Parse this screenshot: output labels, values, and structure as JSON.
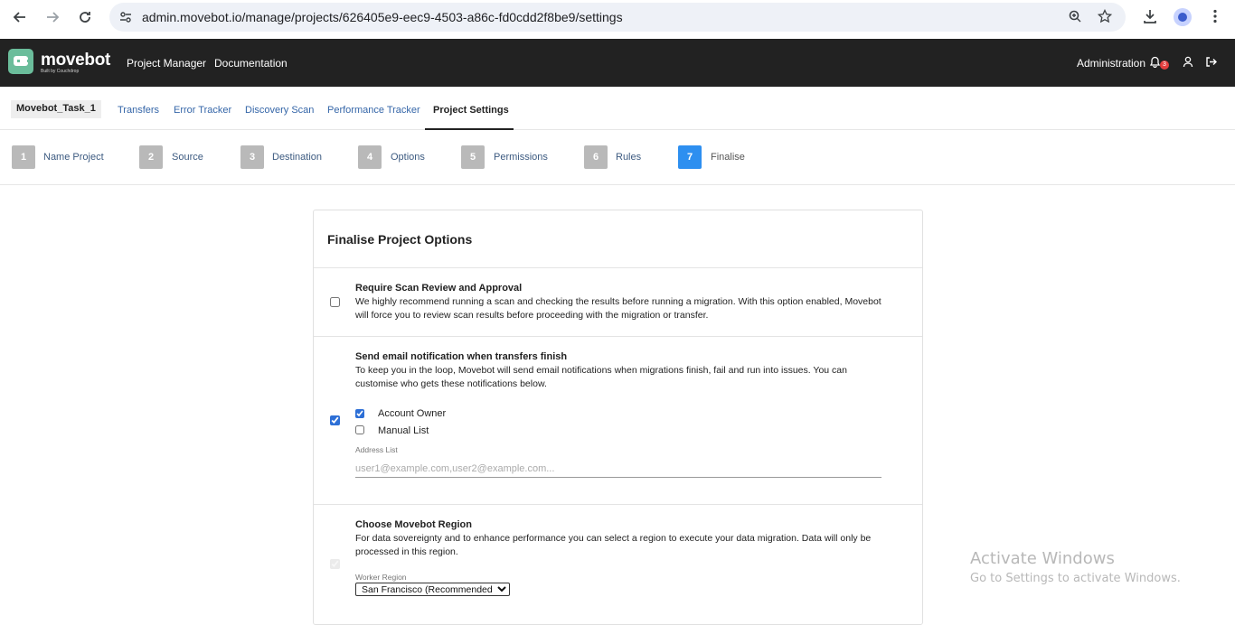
{
  "browser": {
    "url": "admin.movebot.io/manage/projects/626405e9-eec9-4503-a86c-fd0cdd2f8be9/settings",
    "icons": [
      "back-icon",
      "forward-icon",
      "reload-icon",
      "site-settings-icon",
      "zoom-icon",
      "star-icon",
      "download-icon",
      "profile-icon",
      "menu-icon"
    ]
  },
  "header": {
    "logo_text": "movebot",
    "logo_sub": "Built by Couchdrop",
    "nav": [
      "Project Manager",
      "Documentation"
    ],
    "admin_label": "Administration",
    "notification_count": "3",
    "colors": {
      "bg": "#222222",
      "logo": "#6bbd9b"
    }
  },
  "subnav": {
    "project_name": "Movebot_Task_1",
    "tabs": [
      {
        "label": "Transfers",
        "active": false
      },
      {
        "label": "Error Tracker",
        "active": false
      },
      {
        "label": "Discovery Scan",
        "active": false
      },
      {
        "label": "Performance Tracker",
        "active": false
      },
      {
        "label": "Project Settings",
        "active": true
      }
    ]
  },
  "steps": [
    {
      "num": "1",
      "label": "Name Project",
      "active": false
    },
    {
      "num": "2",
      "label": "Source",
      "active": false
    },
    {
      "num": "3",
      "label": "Destination",
      "active": false
    },
    {
      "num": "4",
      "label": "Options",
      "active": false
    },
    {
      "num": "5",
      "label": "Permissions",
      "active": false
    },
    {
      "num": "6",
      "label": "Rules",
      "active": false
    },
    {
      "num": "7",
      "label": "Finalise",
      "active": true
    }
  ],
  "card": {
    "title": "Finalise Project Options",
    "scan_review": {
      "title": "Require Scan Review and Approval",
      "desc": "We highly recommend running a scan and checking the results before running a migration. With this option enabled, Movebot will force you to review scan results before proceeding with the migration or transfer.",
      "checked": false
    },
    "email_notify": {
      "title": "Send email notification when transfers finish",
      "desc": "To keep you in the loop, Movebot will send email notifications when migrations finish, fail and run into issues. You can customise who gets these notifications below.",
      "checked": true,
      "account_owner_label": "Account Owner",
      "account_owner_checked": true,
      "manual_list_label": "Manual List",
      "manual_list_checked": false,
      "address_label": "Address List",
      "address_placeholder": "user1@example.com,user2@example.com..."
    },
    "region": {
      "title": "Choose Movebot Region",
      "desc": "For data sovereignty and to enhance performance you can select a region to execute your data migration. Data will only be processed in this region.",
      "checked": true,
      "worker_label": "Worker Region",
      "selected": "San Francisco (Recommended)"
    }
  },
  "watermark": {
    "title": "Activate Windows",
    "subtitle": "Go to Settings to activate Windows."
  },
  "accent_color": "#2d8ff0"
}
